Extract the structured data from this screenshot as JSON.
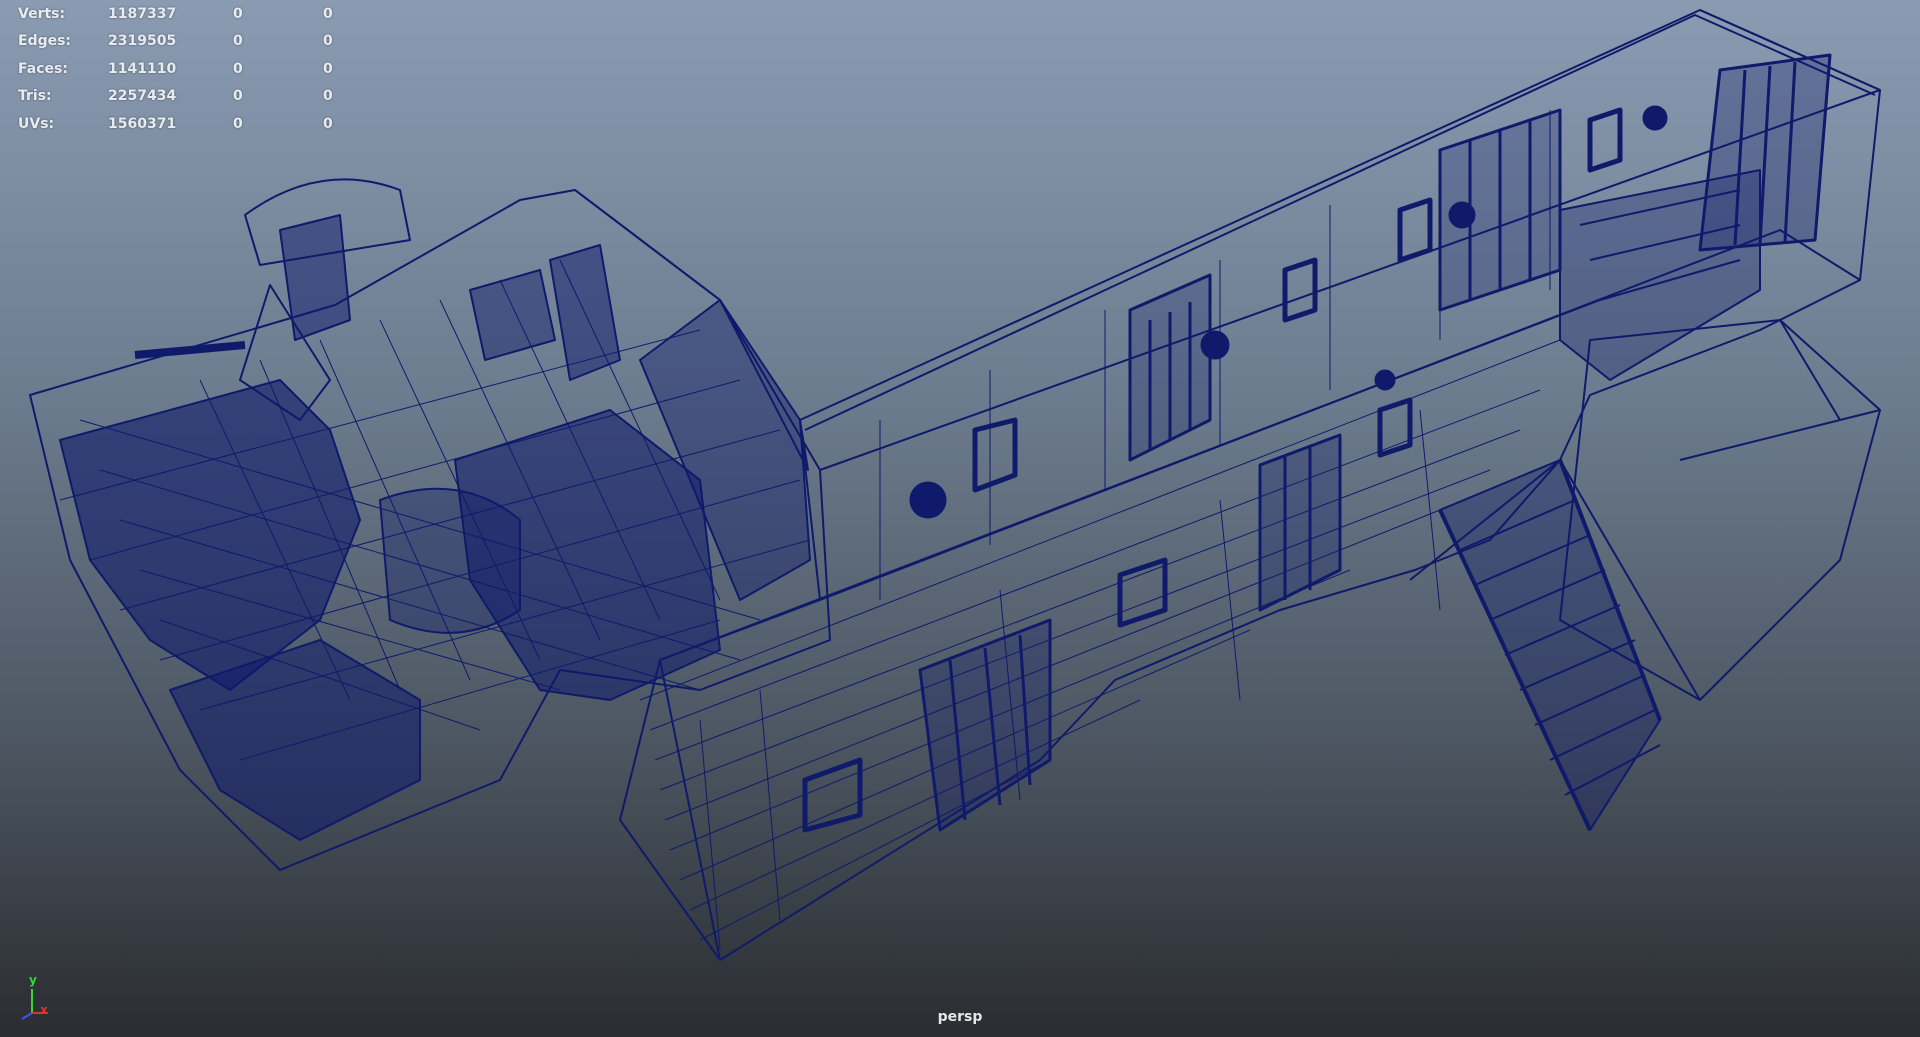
{
  "viewport": {
    "camera": "persp",
    "background_top": "#8a9bb2",
    "background_bottom": "#2a2d31",
    "wireframe_color": "#0f1a6b"
  },
  "hud": {
    "rows": [
      {
        "label": "Verts:",
        "value": "1187337",
        "sel": "0",
        "comp": "0"
      },
      {
        "label": "Edges:",
        "value": "2319505",
        "sel": "0",
        "comp": "0"
      },
      {
        "label": "Faces:",
        "value": "1141110",
        "sel": "0",
        "comp": "0"
      },
      {
        "label": "Tris:",
        "value": "2257434",
        "sel": "0",
        "comp": "0"
      },
      {
        "label": "UVs:",
        "value": "1560371",
        "sel": "0",
        "comp": "0"
      }
    ]
  },
  "axis_gizmo": {
    "y_label": "y",
    "x_label": "x",
    "y_color": "#35d635",
    "x_color": "#e03030",
    "z_color": "#3a52ff"
  }
}
